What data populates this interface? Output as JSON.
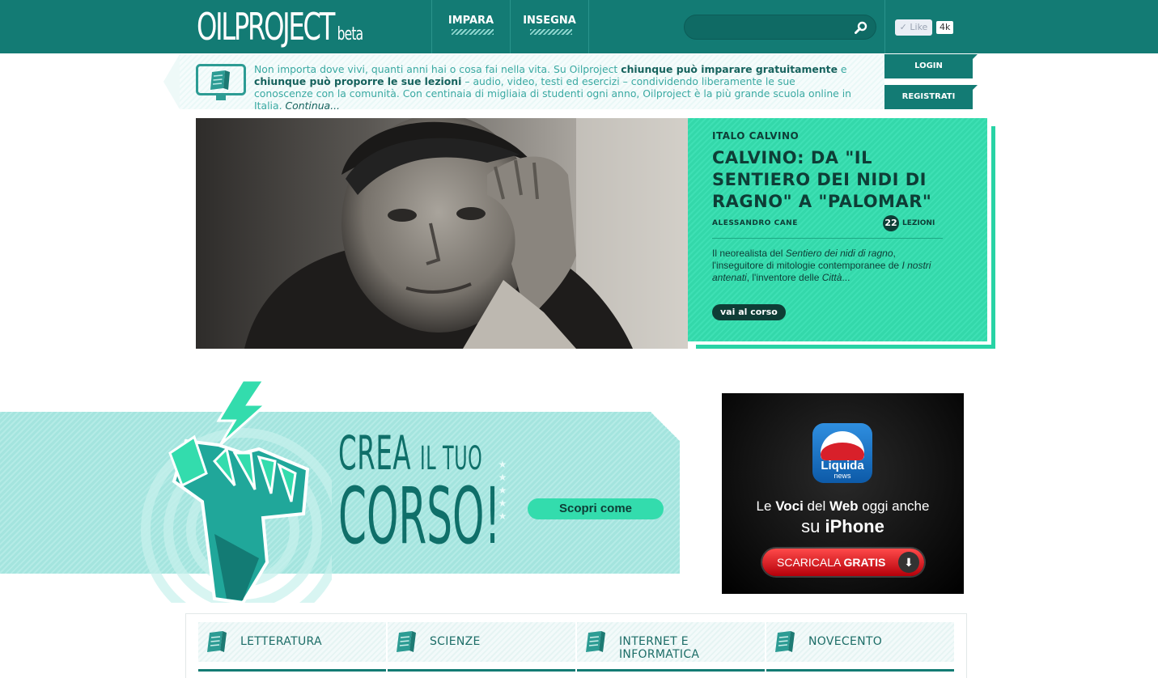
{
  "header": {
    "logo_main": "OILPROJECT",
    "logo_beta": "beta",
    "nav": [
      {
        "label": "IMPARA"
      },
      {
        "label": "INSEGNA"
      }
    ],
    "search": {
      "value": "",
      "placeholder": ""
    },
    "like_label": "Like",
    "like_count": "4k"
  },
  "intro": {
    "t1": "Non importa dove vivi, quanti anni hai o cosa fai nella vita. Su Oilproject ",
    "b1": "chiunque può imparare gratuitamente",
    "t2": " e ",
    "b2": "chiunque può proporre le sue lezioni",
    "t3": " – audio, video, testi ed esercizi – condividendo liberamente le sue conoscenze con la comunità. Con centinaia di migliaia di studenti ogni anno, Oilproject è la più grande scuola online in Italia. ",
    "more": "Continua..."
  },
  "auth": {
    "login": "LOGIN",
    "register": "REGISTRATI"
  },
  "featured": {
    "kicker": "ITALO CALVINO",
    "title": "CALVINO: DA \"IL SENTIERO DEI NIDI DI RAGNO\" A \"PALOMAR\"",
    "author": "ALESSANDRO CANE",
    "lesson_count": "22",
    "lessons_label": "LEZIONI",
    "desc_1": "Il neorealista del ",
    "desc_i1": "Sentiero dei nidi di ragno",
    "desc_2": ", l'inseguitore di mitologie contemporanee de ",
    "desc_i2": "I nostri antenati",
    "desc_3": ", l'inventore delle ",
    "desc_i3": "Città",
    "desc_4": "...",
    "cta": "vai al corso"
  },
  "promo": {
    "line1_big": "CREA",
    "line1_small": "IL TUO",
    "line2": "CORSO!",
    "button": "Scopri come"
  },
  "ad": {
    "brand": "Liquida",
    "brand_sub": "news",
    "line1_a": "Le ",
    "line1_b": "Voci",
    "line1_c": " del ",
    "line1_d": "Web",
    "line1_e": " oggi anche",
    "line2_a": "su ",
    "line2_b": "iPhone",
    "cta_a": "SCARICALA ",
    "cta_b": "GRATIS"
  },
  "categories": [
    {
      "label": "LETTERATURA"
    },
    {
      "label": "SCIENZE"
    },
    {
      "label": "INTERNET E INFORMATICA"
    },
    {
      "label": "NOVECENTO"
    }
  ],
  "colors": {
    "brand": "#137b74",
    "accent": "#3ee0b4",
    "dark": "#0e3d36"
  }
}
